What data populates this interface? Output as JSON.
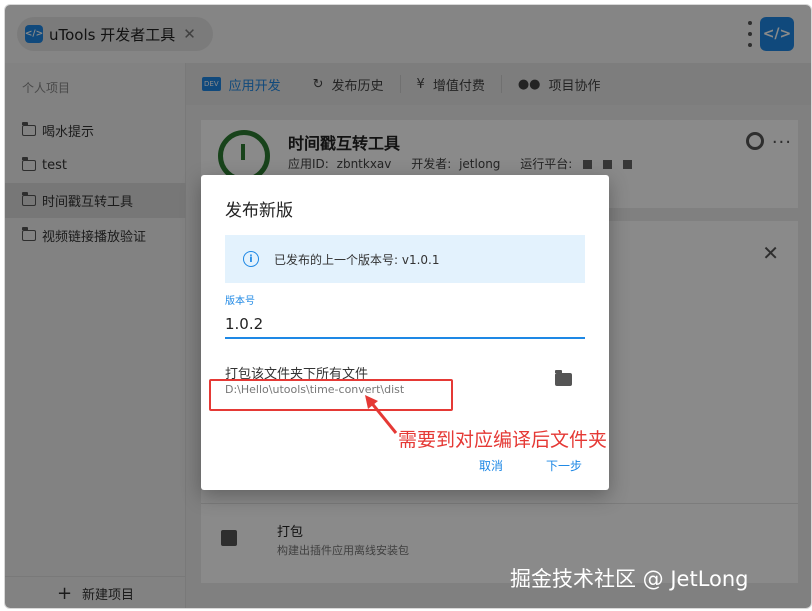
{
  "window": {
    "tab_title": "uTools 开发者工具",
    "tab_close": "✕",
    "logo_glyph": "</>",
    "accent": "#1e88e5"
  },
  "sidebar": {
    "heading": "个人项目",
    "items": [
      {
        "label": "喝水提示"
      },
      {
        "label": "test"
      },
      {
        "label": "时间戳互转工具"
      },
      {
        "label": "视频链接播放验证"
      }
    ],
    "new_project": "新建项目"
  },
  "tabs": [
    {
      "label": "应用开发",
      "badge": "DEV"
    },
    {
      "label": "发布历史",
      "icon": "history-icon"
    },
    {
      "label": "增值付费",
      "icon": "yen-icon"
    },
    {
      "label": "项目协作",
      "icon": "group-icon"
    }
  ],
  "project": {
    "name": "时间戳互转工具",
    "id_label": "应用ID:",
    "id_value": "zbntkxav",
    "developer_label": "开发者:",
    "developer_value": "jetlong",
    "platform_label": "运行平台:"
  },
  "pack": {
    "title": "打包",
    "description": "构建出插件应用离线安装包"
  },
  "dialog": {
    "title": "发布新版",
    "info_text": "已发布的上一个版本号: v1.0.1",
    "version_label": "版本号",
    "version_value": "1.0.2",
    "folder_label": "打包该文件夹下所有文件",
    "folder_path": "D:\\Hello\\utools\\time-convert\\dist",
    "cancel_label": "取消",
    "next_label": "下一步"
  },
  "annotation": {
    "text": "需要到对应编译后文件夹",
    "color": "#e53935"
  },
  "watermark": "掘金技术社区 @ JetLong"
}
